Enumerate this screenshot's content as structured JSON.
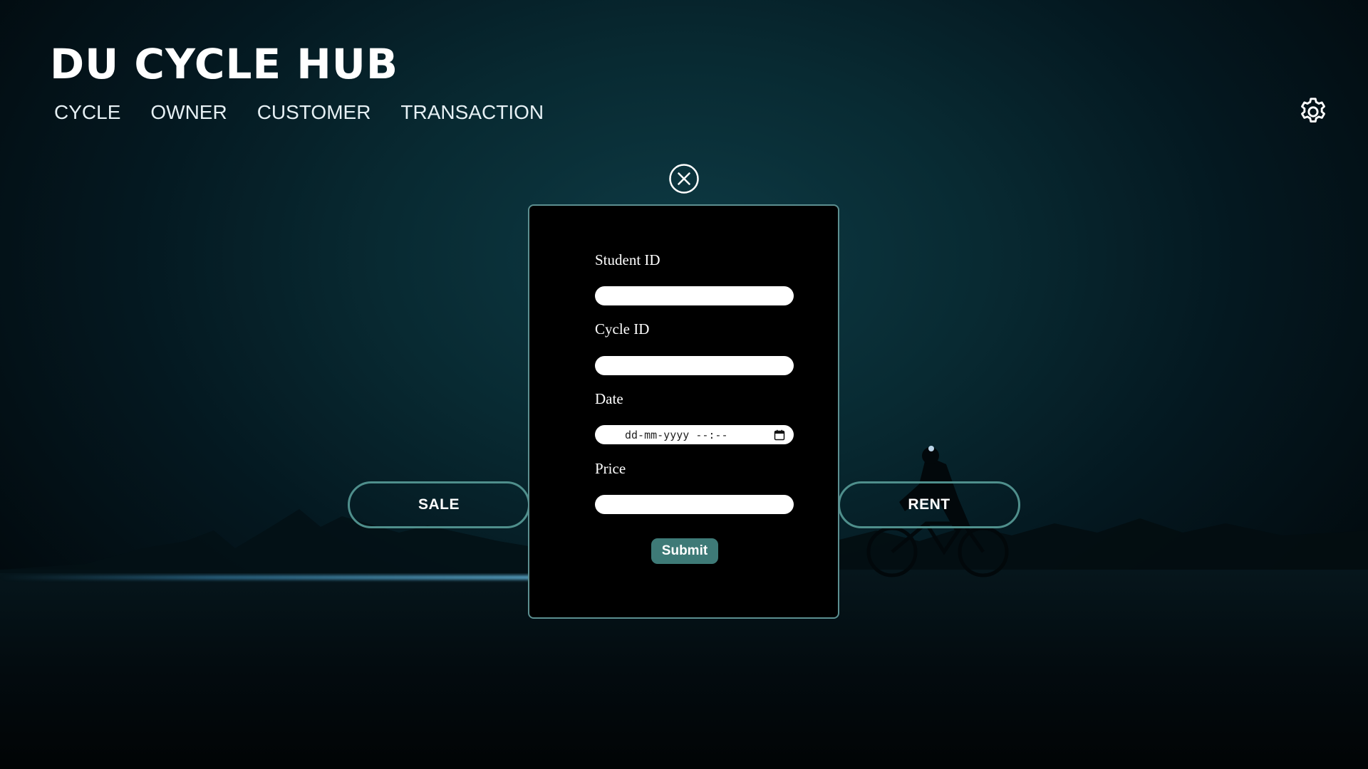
{
  "header": {
    "title": "DU CYCLE HUB"
  },
  "nav": {
    "items": [
      {
        "label": "CYCLE"
      },
      {
        "label": "OWNER"
      },
      {
        "label": "CUSTOMER"
      },
      {
        "label": "TRANSACTION"
      }
    ]
  },
  "icons": {
    "settings": "gear-icon",
    "close": "close-circle-icon",
    "calendar": "calendar-icon"
  },
  "actions": {
    "sale_label": "SALE",
    "rent_label": "RENT"
  },
  "form": {
    "fields": [
      {
        "label": "Student ID",
        "value": ""
      },
      {
        "label": "Cycle ID",
        "value": ""
      },
      {
        "label": "Date",
        "placeholder": "dd-mm-yyyy --:--"
      },
      {
        "label": "Price",
        "value": ""
      }
    ],
    "submit_label": "Submit"
  },
  "colors": {
    "accent": "#3e7a77",
    "pill_border": "#4f8f8c",
    "modal_border": "#5c8f90",
    "modal_background": "#000000"
  }
}
